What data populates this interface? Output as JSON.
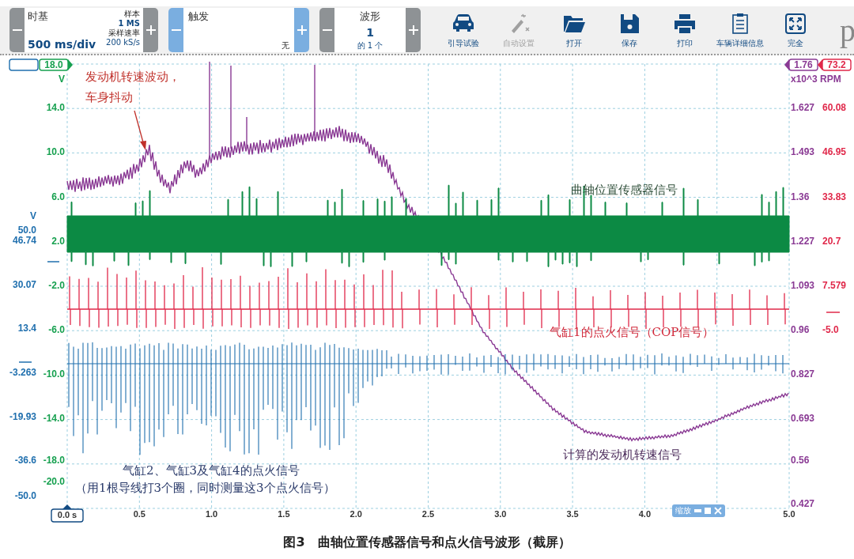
{
  "toolbar": {
    "timebase": {
      "label": "时基",
      "value": "500 ms/div",
      "samples_label": "样本",
      "samples": "1 MS",
      "rate_label": "采样速率",
      "rate": "200 kS/s"
    },
    "trigger": {
      "label": "触发",
      "mode": "无"
    },
    "waveforms": {
      "label": "波形",
      "value": "1",
      "count": "的 1 个"
    },
    "tools": [
      {
        "kind": "car",
        "label": "引导试验",
        "disabled": false
      },
      {
        "kind": "wand",
        "label": "自动设置",
        "disabled": true
      },
      {
        "kind": "folder",
        "label": "打开",
        "disabled": false
      },
      {
        "kind": "save",
        "label": "保存",
        "disabled": false
      },
      {
        "kind": "print",
        "label": "打印",
        "disabled": false
      },
      {
        "kind": "clipboard",
        "label": "车辆详细信息",
        "disabled": false
      },
      {
        "kind": "fullscreen",
        "label": "完全",
        "disabled": false
      }
    ],
    "logo": "p"
  },
  "plot": {
    "axes": [
      {
        "kind": "left_inner",
        "color": "#16a04f",
        "marker": "18.0",
        "unit": "V",
        "ticks": [
          "14.0",
          "10.0",
          "6.0",
          "2.0",
          "-2.0",
          "-6.0",
          "-10.0",
          "-14.0",
          "-18.0",
          "-20.0"
        ]
      },
      {
        "kind": "left_outer",
        "color": "#1f6fae",
        "unit": "V",
        "ticks": [
          "50.0",
          "46.74",
          "30.07",
          "13.4",
          "-3.263",
          "-19.93",
          "-36.6",
          "-50.0"
        ]
      },
      {
        "kind": "right_inner",
        "color": "#8a3a94",
        "marker": "1.76",
        "unit": "x10^3 RPM",
        "ticks": [
          "1.627",
          "1.493",
          "1.36",
          "1.227",
          "1.093",
          "0.96",
          "0.827",
          "0.693",
          "0.56",
          "0.427"
        ]
      },
      {
        "kind": "right_outer",
        "color": "#e0284a",
        "marker": "73.2",
        "ticks": [
          "60.08",
          "46.95",
          "33.83",
          "20.7",
          "7.579",
          "-5.0"
        ]
      }
    ],
    "x_ticks": [
      "0.0 s",
      "0.5",
      "1.0",
      "1.5",
      "2.0",
      "2.5",
      "3.0",
      "3.5",
      "4.0"
    ],
    "x_tick_end": "5.0",
    "traces": [
      {
        "kind": "rpm"
      },
      {
        "kind": "crank"
      },
      {
        "kind": "cop"
      },
      {
        "kind": "ignition"
      }
    ],
    "annotations": [
      {
        "kind": "callout",
        "lines": [
          "发动机转速波动，",
          "车身抖动"
        ],
        "color": "#c0302a"
      },
      {
        "kind": "label",
        "lines": [
          "曲轴位置传感器信号"
        ],
        "color": "#2f4f3a"
      },
      {
        "kind": "label",
        "lines": [
          "气缸1的点火信号（COP信号）"
        ],
        "color": "#d0283a"
      },
      {
        "kind": "label",
        "lines": [
          "计算的发动机转速信号"
        ],
        "color": "#4a2a5a"
      },
      {
        "kind": "label",
        "lines": [
          "气缸2、气缸3及气缸4的点火信号",
          "（用1根导线打3个圈，同时测量这3个点火信号）"
        ],
        "color": "#2a3a6a"
      }
    ],
    "zoom_control": {
      "label": "缩放"
    }
  },
  "caption": "图3　曲轴位置传感器信号和点火信号波形（截屏）"
}
